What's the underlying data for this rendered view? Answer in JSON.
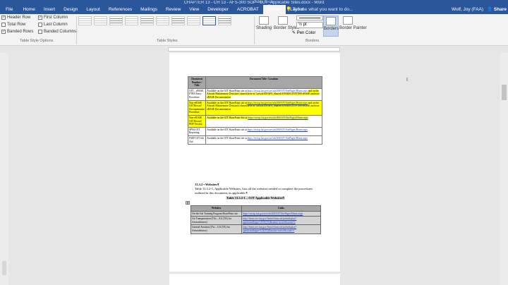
{
  "window": {
    "title": "CHAPTER 13 - CH 13 - AFS-300 SOP - OJT_Applicable Sites.docx - Word",
    "context_label": "Table Tools",
    "tell_me": "Tell me what you want to do...",
    "user": "Wolf, Joy (FAA)",
    "share": "Share"
  },
  "tabs": [
    "File",
    "Home",
    "Insert",
    "Design",
    "Layout",
    "References",
    "Mailings",
    "Review",
    "View",
    "Developer",
    "ACROBAT"
  ],
  "context_tabs": [
    "Design",
    "Layout"
  ],
  "ribbon": {
    "style_options": {
      "items": [
        {
          "label": "Header Row",
          "checked": "✓"
        },
        {
          "label": "First Column",
          "checked": "✓"
        },
        {
          "label": "Total Row",
          "checked": ""
        },
        {
          "label": "Last Column",
          "checked": ""
        },
        {
          "label": "Banded Rows",
          "checked": "✓"
        },
        {
          "label": "Banded Columns",
          "checked": ""
        }
      ],
      "group_label": "Table Style Options"
    },
    "table_styles_label": "Table Styles",
    "shading": "Shading",
    "border_styles": "Border Styles",
    "pen_weight": "½ pt",
    "pen_color": "Pen Color",
    "borders": "Borders",
    "border_painter": "Border Painter",
    "borders_group_label": "Borders"
  },
  "document": {
    "table1": {
      "headers": [
        "Document Number / Title",
        "Document Title / Location"
      ],
      "rows": [
        {
          "label": "OJT – eBASE PTRS Entry Procedure",
          "text": "Available on the OJT SharePoint site at ",
          "link": "https://avssp.faa.gov/avs/afs300/OJT/SitePages/Home.aspx",
          "hl": "and on the Aircraft Maintenance Division's shared drive at \\\\avsafs300\\AFS_Shared\\AFS300\\OJT\\PTRS eBASE and non-eBASE Documentation"
        },
        {
          "label": "Non-eBASE OJT Record Documentation Procedure",
          "text": "Available on the OJT SharePoint site at ",
          "link": "https://avssp.faa.gov/avs/afs300/OJT/SitePages/Home.aspx",
          "hl": "and on the Aircraft Maintenance Division's shared drive at \\\\avsafs300\\AFS_Shared\\AFS300\\OJT\\PTRS eBASE and non-eBASE Documentation"
        },
        {
          "label": "Non-eBASE OJT Record PDF Version",
          "text": "Available on the OJT SharePoint Site at ",
          "link": "https://avssp.faa.gov/avs/afs300/OJT/SitePages/Home.aspx",
          "hl": ""
        },
        {
          "label": "SPAS OJT Reporting",
          "text": "Available on the OJT SharePoint site at ",
          "link": "https://avssp.faa.gov/avs/afs300/OJT/SitePages/Home.aspx",
          "hl": ""
        },
        {
          "label": "FSEP OJT Job Aid",
          "text": "Available on the OJT SharePoint site at ",
          "link": "https://avssp.faa.gov/avs/afs300/OJT/SitePages/Home.aspx",
          "hl": ""
        }
      ]
    },
    "section_heading": "13.3.2 • Websites¶",
    "paragraph": "Table 13.3.2-1, Applicable Websites, lists all the websites needed to complete the procedures outlined in this document, as applicable.¶",
    "table2_caption": "Table 13.3.2-1 – OJT Applicable Websites¶",
    "table2": {
      "headers": [
        "Websites",
        "Links"
      ],
      "rows": [
        {
          "site": "On-the-Job Training Program SharePoint site",
          "link": "https://avssp.faa.gov/avs/afs300/OJT/SitePages/Home.aspx"
        },
        {
          "site": "Air Transportation (TAs – AA (TA) for Airworthiness)",
          "link": "http://fsims.avs.faa.gov/fsims/fsims.nsf/pubsdisplay?openform&type=ATA(TA)&status=active&count=1"
        },
        {
          "site": "General Aviation (TAs – GA (TA) for Airworthiness)",
          "link": "http://fsims.avs.faa.gov/fsims/fsims.nsf/pubsdisplay?openform&type=GA(TA)&status=active&count=1"
        }
      ]
    }
  }
}
